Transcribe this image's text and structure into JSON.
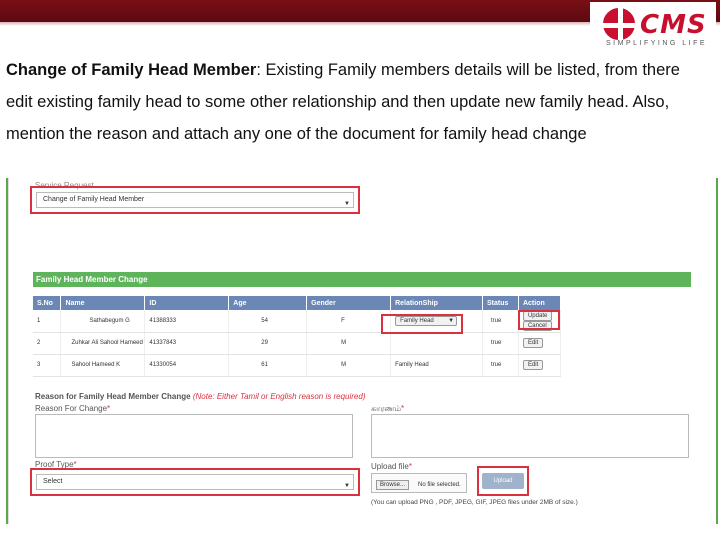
{
  "header": {
    "logo_text": "CMS",
    "logo_tagline": "SIMPLIFYING LIFE"
  },
  "description": {
    "title": "Change of Family Head Member",
    "text": ": Existing Family members details will be listed, from there edit existing family head to some other relationship and then update new family head. Also, mention the reason and attach any one of the document for family head change"
  },
  "form": {
    "service_request_label": "Service Request",
    "service_request_value": "Change of Family Head Member",
    "section_title": "Family Head Member Change",
    "table": {
      "columns": [
        "S.No",
        "Name",
        "ID",
        "Age",
        "Gender",
        "RelationShip",
        "Status",
        "Action"
      ],
      "rows": [
        {
          "sno": "1",
          "name": "Sathabegum G",
          "id": "41388333",
          "age": "54",
          "gender": "F",
          "relationship": "Family Head",
          "status": "true",
          "action1": "Update",
          "action2": "Cancel"
        },
        {
          "sno": "2",
          "name": "Zuhkar Ali Sahool Hameed",
          "id": "41337843",
          "age": "29",
          "gender": "M",
          "relationship": "",
          "status": "true",
          "action1": "Edit"
        },
        {
          "sno": "3",
          "name": "Sahool Hameed K",
          "id": "41330054",
          "age": "61",
          "gender": "M",
          "relationship": "Family Head",
          "status": "true",
          "action1": "Edit"
        }
      ]
    },
    "reason_heading": "Reason for Family Head Member Change",
    "reason_note": "(Note: Either Tamil or English reason is required)",
    "reason_label": "Reason For Change",
    "reason_tamil_label": "காரணம்",
    "proof_label": "Proof Type",
    "proof_value": "Select",
    "upload_label": "Upload file",
    "browse_label": "Browse...",
    "no_file_label": "No file selected.",
    "upload_button": "Upload",
    "upload_hint": "(You can upload PNG , PDF, JPEG, GIF, JPEG files under 2MB of size.)"
  },
  "colors": {
    "topbar": "#7a0f16",
    "brand_red": "#c8102e",
    "section_green": "#5db45a",
    "table_header": "#6a87b5",
    "highlight_red": "#d9313e"
  }
}
